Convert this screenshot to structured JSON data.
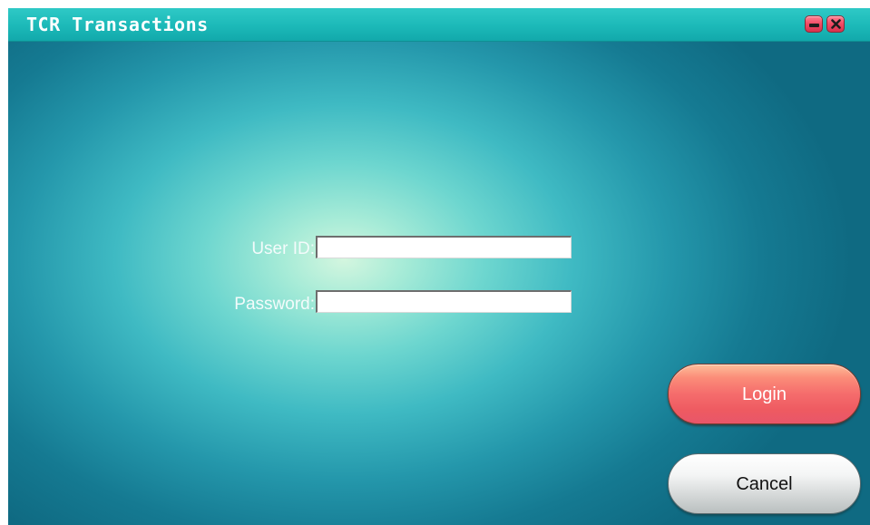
{
  "window": {
    "title": "TCR Transactions",
    "minimize_icon": "minimize-icon",
    "close_icon": "close-icon"
  },
  "form": {
    "user_id_label": "User ID:",
    "user_id_value": "",
    "password_label": "Password:",
    "password_value": ""
  },
  "buttons": {
    "login_label": "Login",
    "cancel_label": "Cancel"
  },
  "colors": {
    "titlebar": "#1cb9b8",
    "login_button": "#f56c6c",
    "window_buttons": "#f14a64"
  }
}
